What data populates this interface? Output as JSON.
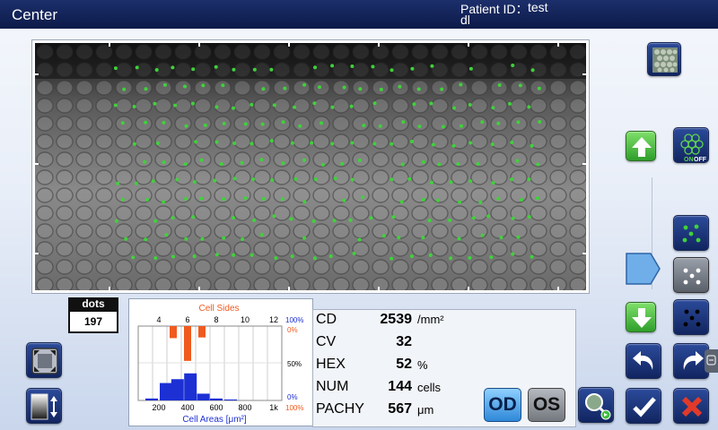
{
  "header": {
    "view_title": "Center",
    "patient_id_label": "Patient ID：",
    "patient_id": "test",
    "patient_name": "dl"
  },
  "dots": {
    "label": "dots",
    "count": "197"
  },
  "histogram": {
    "sides_title": "Cell Sides",
    "areas_title": "Cell Areas [μm²]",
    "sides_ticks": [
      "4",
      "6",
      "8",
      "10",
      "12"
    ],
    "areas_ticks": [
      "200",
      "400",
      "600",
      "800",
      "1k"
    ],
    "right_labels": {
      "top_blue": "100%",
      "top_red": "0%",
      "mid": "50%",
      "bot_blue": "0%",
      "bot_red": "100%"
    },
    "colors": {
      "sides": "#f05a1e",
      "areas": "#1c30d4",
      "grid": "#cfcfcf",
      "title": "#f05a1e",
      "axis_label": "#1c30d4"
    },
    "sides_values": [
      {
        "sides": 4,
        "value": 0
      },
      {
        "sides": 5,
        "value": 0.18
      },
      {
        "sides": 6,
        "value": 0.52
      },
      {
        "sides": 7,
        "value": 0.17
      },
      {
        "sides": 8,
        "value": 0
      },
      {
        "sides": 9,
        "value": 0
      },
      {
        "sides": 10,
        "value": 0
      },
      {
        "sides": 11,
        "value": 0
      }
    ],
    "area_values": [
      {
        "area": 150,
        "value": 0.02
      },
      {
        "area": 250,
        "value": 0.18
      },
      {
        "area": 330,
        "value": 0.22
      },
      {
        "area": 420,
        "value": 0.28
      },
      {
        "area": 510,
        "value": 0.07
      },
      {
        "area": 600,
        "value": 0.02
      },
      {
        "area": 700,
        "value": 0.01
      },
      {
        "area": 800,
        "value": 0
      }
    ]
  },
  "stats": [
    {
      "label": "CD",
      "value": "2539",
      "unit": "/mm²"
    },
    {
      "label": "CV",
      "value": "32",
      "unit": ""
    },
    {
      "label": "HEX",
      "value": "52",
      "unit": "%"
    },
    {
      "label": "NUM",
      "value": "144",
      "unit": "cells"
    },
    {
      "label": "PACHY",
      "value": "567",
      "unit": "μm"
    }
  ],
  "buttons": {
    "od_label": "OD",
    "os_label": "OS",
    "overlay_toggle_on": "ON",
    "overlay_toggle_off": "OFF"
  },
  "colors": {
    "accent_green": "#3fbf3c",
    "cancel_red": "#e23a2a",
    "navy": "#17306e",
    "slider_blue": "#6faee8"
  }
}
